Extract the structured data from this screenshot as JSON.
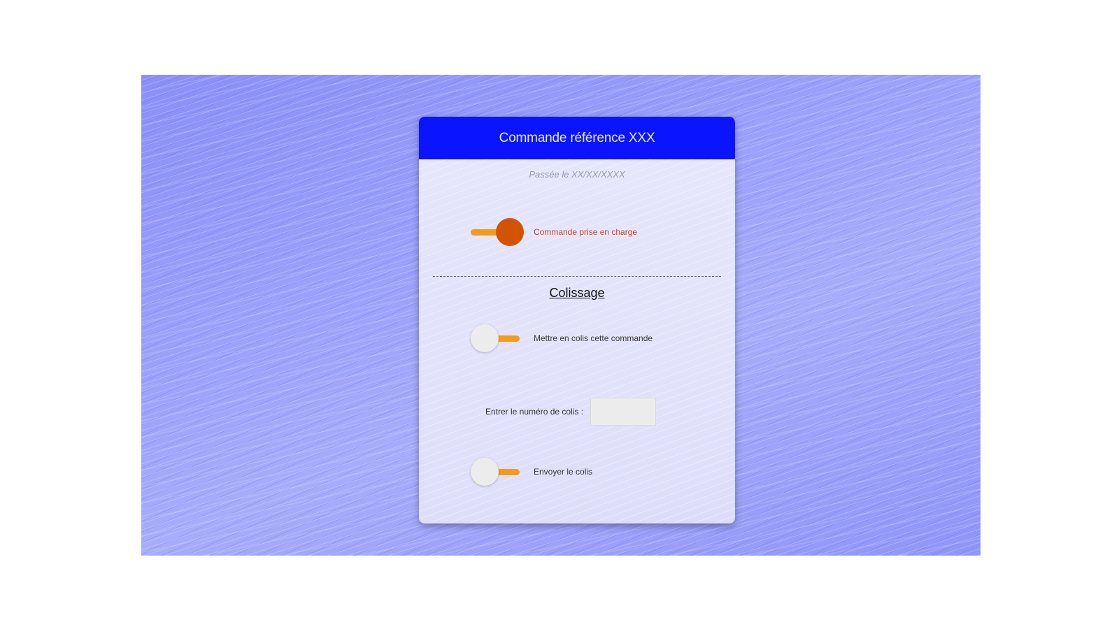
{
  "card": {
    "title": "Commande référence XXX",
    "date_text": "Passée le XX/XX/XXXX"
  },
  "order_status": {
    "label": "Commande prise en charge",
    "checked": true
  },
  "packaging": {
    "section_title": "Colissage",
    "pack_toggle": {
      "label": "Mettre en colis cette commande",
      "checked": false
    },
    "parcel_number": {
      "label": "Entrer le numéro de colis :",
      "value": ""
    },
    "send_toggle": {
      "label": "Envoyer le colis",
      "checked": false
    }
  },
  "colors": {
    "header_bg": "#0a14ff",
    "accent_orange": "#f59b1c",
    "knob_active": "#d35400",
    "active_label": "#d3431e"
  }
}
